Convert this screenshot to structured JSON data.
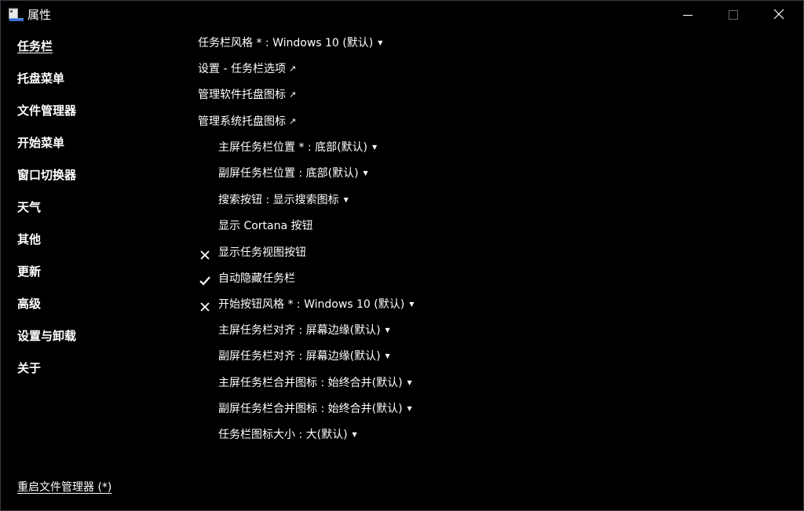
{
  "window": {
    "title": "属性",
    "icon": "window-app-icon",
    "controls": {
      "minimize_icon": "minimize-icon",
      "maximize_icon": "maximize-icon",
      "close_icon": "close-icon"
    }
  },
  "sidebar": {
    "items": [
      {
        "label": "任务栏",
        "active": true
      },
      {
        "label": "托盘菜单"
      },
      {
        "label": "文件管理器"
      },
      {
        "label": "开始菜单"
      },
      {
        "label": "窗口切换器"
      },
      {
        "label": "天气"
      },
      {
        "label": "其他"
      },
      {
        "label": "更新"
      },
      {
        "label": "高级"
      },
      {
        "label": "设置与卸载"
      },
      {
        "label": "关于"
      }
    ],
    "restart_label": "重启文件管理器 (*)"
  },
  "settings": [
    {
      "label": "任务栏风格 * : Windows 10 (默认)",
      "kind": "dropdown"
    },
    {
      "label": "设置 - 任务栏选项",
      "kind": "link"
    },
    {
      "label": "管理软件托盘图标",
      "kind": "link"
    },
    {
      "label": "管理系统托盘图标",
      "kind": "link"
    },
    {
      "label": "主屏任务栏位置 * : 底部(默认)",
      "kind": "dropdown"
    },
    {
      "label": "副屏任务栏位置 : 底部(默认)",
      "kind": "dropdown"
    },
    {
      "label": "搜索按钮 : 显示搜索图标",
      "kind": "dropdown"
    },
    {
      "label": "显示 Cortana 按钮",
      "kind": "checkbox",
      "state": "off"
    },
    {
      "label": "显示任务视图按钮",
      "kind": "checkbox",
      "state": "on"
    },
    {
      "label": "自动隐藏任务栏",
      "kind": "checkbox",
      "state": "off"
    },
    {
      "label": "开始按钮风格 * : Windows 10 (默认)",
      "kind": "dropdown"
    },
    {
      "label": "主屏任务栏对齐 : 屏幕边缘(默认)",
      "kind": "dropdown"
    },
    {
      "label": "副屏任务栏对齐 : 屏幕边缘(默认)",
      "kind": "dropdown"
    },
    {
      "label": "主屏任务栏合并图标 : 始终合并(默认)",
      "kind": "dropdown"
    },
    {
      "label": "副屏任务栏合并图标 : 始终合并(默认)",
      "kind": "dropdown"
    },
    {
      "label": "任务栏图标大小 : 大(默认)",
      "kind": "dropdown"
    }
  ],
  "icons": {
    "dropdown": "caret-down-icon",
    "link": "external-link-arrow-icon",
    "checked": "checkmark-icon",
    "unchecked": "cross-icon"
  },
  "colors": {
    "background": "#000000",
    "text": "#ffffff",
    "border": "#3a3a4a"
  }
}
